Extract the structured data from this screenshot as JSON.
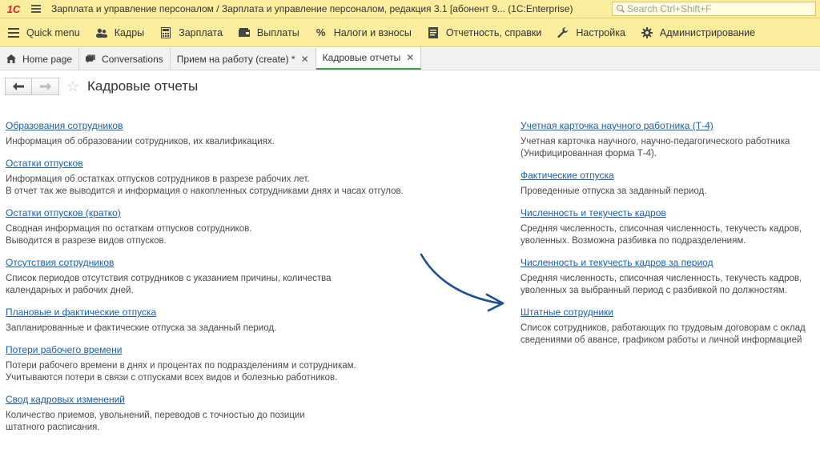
{
  "titlebar": {
    "logo": "1С",
    "title": "Зарплата и управление персоналом / Зарплата и управление персоналом, редакция 3.1 [абонент 9...   (1C:Enterprise)",
    "search_placeholder": "Search Ctrl+Shift+F"
  },
  "menu": [
    {
      "label": "Quick menu",
      "icon": "menu-icon"
    },
    {
      "label": "Кадры",
      "icon": "people-icon"
    },
    {
      "label": "Зарплата",
      "icon": "calculator-icon"
    },
    {
      "label": "Выплаты",
      "icon": "wallet-icon"
    },
    {
      "label": "Налоги и взносы",
      "icon": "percent-icon"
    },
    {
      "label": "Отчетность, справки",
      "icon": "reports-icon"
    },
    {
      "label": "Настройка",
      "icon": "wrench-icon"
    },
    {
      "label": "Администрирование",
      "icon": "gear-icon"
    }
  ],
  "tabs": [
    {
      "label": "Home page",
      "icon": "home-icon",
      "closable": false
    },
    {
      "label": "Conversations",
      "icon": "chat-icon",
      "closable": false
    },
    {
      "label": "Прием на работу (create) *",
      "closable": true
    },
    {
      "label": "Кадровые отчеты",
      "closable": true,
      "active": true
    }
  ],
  "page": {
    "title": "Кадровые отчеты"
  },
  "reports_left": [
    {
      "title": "Образования сотрудников",
      "desc": "Информация об образовании сотрудников, их квалификациях."
    },
    {
      "title": "Остатки отпусков",
      "desc": "Информация об остатках отпусков сотрудников в разрезе рабочих лет.\nВ отчет так же выводится и информация о накопленных сотрудниками днях и часах отгулов."
    },
    {
      "title": "Остатки отпусков (кратко)",
      "desc": "Сводная информация по остаткам отпусков сотрудников.\nВыводится в разрезе видов отпусков."
    },
    {
      "title": "Отсутствия сотрудников",
      "desc": "Список периодов отсутствия сотрудников с указанием причины, количества\nкалендарных и рабочих дней."
    },
    {
      "title": "Плановые и фактические отпуска",
      "desc": "Запланированные и фактические отпуска за заданный период."
    },
    {
      "title": "Потери рабочего времени",
      "desc": "Потери рабочего времени в днях и процентах по подразделениям и сотрудникам.\nУчитываются потери в связи с отпусками всех видов и болезнью работников."
    },
    {
      "title": "Свод кадровых изменений",
      "desc": "Количество приемов, увольнений, переводов с точностью до позиции\nштатного расписания."
    }
  ],
  "reports_right": [
    {
      "title": "Учетная карточка научного работника (Т-4)",
      "desc": "Учетная карточка научного, научно-педагогического работника\n(Унифицированная форма Т-4)."
    },
    {
      "title": "Фактические отпуска",
      "desc": "Проведенные отпуска за заданный период."
    },
    {
      "title": "Численность и текучесть кадров",
      "desc": "Средняя численность, списочная численность, текучесть кадров,\nуволенных. Возможна разбивка по подразделениям."
    },
    {
      "title": "Численность и текучесть кадров за период",
      "desc": "Средняя численность, списочная численность, текучесть кадров,\nуволенных за выбранный период с разбивкой по должностям."
    },
    {
      "title": "Штатные сотрудники",
      "desc": "Список сотрудников, работающих по трудовым договорам с оклад\nсведениями об авансе, графиком работы и личной информацией"
    }
  ],
  "colors": {
    "titlebar_bg": "#fbed9e",
    "link": "#1d5fa8",
    "active_tab_underline": "#3f9a49",
    "arrow": "#1e4f8c"
  }
}
